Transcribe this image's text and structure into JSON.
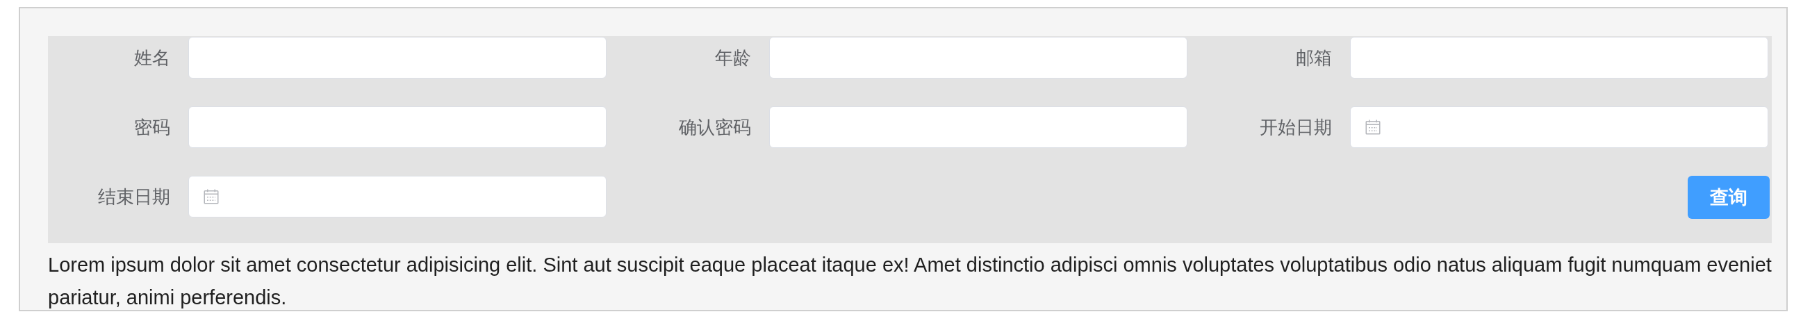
{
  "form": {
    "fields": [
      {
        "label": "姓名",
        "kind": "text"
      },
      {
        "label": "年龄",
        "kind": "text"
      },
      {
        "label": "邮箱",
        "kind": "text"
      },
      {
        "label": "密码",
        "kind": "text"
      },
      {
        "label": "确认密码",
        "kind": "text"
      },
      {
        "label": "开始日期",
        "kind": "date"
      },
      {
        "label": "结束日期",
        "kind": "date"
      }
    ],
    "button": "查询"
  },
  "paragraph": "Lorem ipsum dolor sit amet consectetur adipisicing elit. Sint aut suscipit eaque placeat itaque ex! Amet distinctio adipisci omnis voluptates voluptatibus odio natus aliquam fugit numquam eveniet pariatur, animi perferendis."
}
